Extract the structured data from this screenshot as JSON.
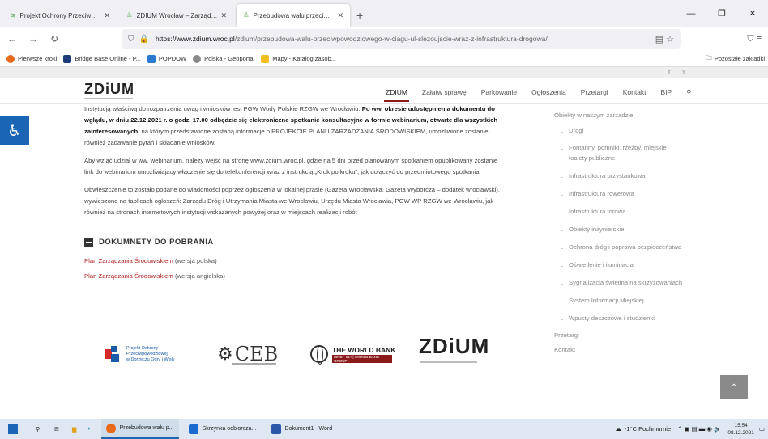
{
  "browser": {
    "tabs": [
      {
        "label": "Projekt Ochrony Przeciwpowod",
        "active": false
      },
      {
        "label": "ZDIUM Wrocław – Zarząd Dróg",
        "active": false
      },
      {
        "label": "Przebudowa wału przeciwpowo",
        "active": true
      }
    ],
    "new_tab": "+",
    "url_domain": "https://www.zdium.wroc.pl",
    "url_path": "/zdium/przebudowa-walu-przeciwpowodziowego-w-ciagu-ul-slezoujscie-wraz-z-infrastruktura-drogowa/",
    "bookmarks": [
      {
        "label": "Pierwsze kroki",
        "color": "#e86a1a"
      },
      {
        "label": "Bridge Base Online - P...",
        "color": "#1c3d7a"
      },
      {
        "label": "POPDOW",
        "color": "#2a7bd0"
      },
      {
        "label": "Polska - Geoportal",
        "color": "#8a8a8a"
      },
      {
        "label": "Mapy - Katalog zasob...",
        "color": "#f0c020"
      }
    ],
    "other_bookmarks": "Pozostałe zakładki"
  },
  "site": {
    "logo": "ZDiUM",
    "social": {
      "facebook": "f",
      "twitter": "𝕏"
    },
    "menu": [
      "ZDIUM",
      "Załatw sprawę",
      "Parkowanie",
      "Ogłoszenia",
      "Przetargi",
      "Kontakt",
      "BIP"
    ],
    "accent": "#8b1a1a"
  },
  "content": {
    "p1_a": "Instytucją właściwą do rozpatrzenia uwag i wniosków jest PGW Wody Polskie RZGW we Wrocławiu.",
    "p1_b": " Po ww. okresie udostępnienia dokumentu do wglądu, w dniu 22.12.2021 r. o godz. 17.00 odbędzie się elektroniczne spotkanie konsultacyjne w formie webinarium, otwarte dla wszystkich zainteresowanych,",
    "p1_c": " na którym przedstawione  zostaną informacje o PROJEKCIE PLANU ZARZADZANIA ŚRODOWISKIEM, umożliwione zostanie również zadawanie  pytań i składanie wniosków.",
    "p2": "Aby wziąć udział w ww. webinarium, należy wejść na stronę www.zdium.wroc.pl, gdzie na 5 dni przed planowanym spotkaniem opublikowany zostanie link do webinarium umożliwiający włączenie się do telekonferencji wraz z instrukcją „Krok po kroku”, jak dołączyć do przedmiotowego spotkania.",
    "p3": "Obwieszczenie to zostało podane do wiadomości poprzez ogłoszenia w lokalnej prasie (Gazeta Wrocławska, Gazeta Wyborcza – dodatek wrocławski), wywieszone na tablicach ogłoszeń: Zarządu Dróg i Utrzymania Miasta we Wrocławiu, Urzędu Miasta Wrocławia, PGW WP RZGW we Wrocławiu, jak również na stronach internetowych instytucji wskazanych powyżej oraz w miejscach realizacji robót",
    "downloads_heading": "DOKUMNETY DO POBRANIA",
    "download1_link": "Plan Zarządzania Środowiskiem",
    "download1_suffix": " (wersja polska)",
    "download2_link": "Plan Zarządzania Środowiskiem",
    "download2_suffix": " (wersja angielska)",
    "logos": {
      "project": [
        "Projekt Ochrony",
        "Przeciwpowodziowej",
        "w Dorzeczu Odry i Wisły"
      ],
      "ceb": "CEB",
      "worldbank": "THE WORLD BANK",
      "worldbank_sub": "IBRD • IDA | WORLD BANK GROUP",
      "zdium": "ZDiUM"
    }
  },
  "sidebar": {
    "top": "Obiekty w naszym zarządzie",
    "items": [
      "Drogi",
      "Fontanny, pomniki, rzeźby, miejskie",
      "toalety publiczne",
      "Infrastruktura przystankowa",
      "Infrastruktura rowerowa",
      "Infrastruktura torowa",
      "Obiekty inżynierskie",
      "Ochrona dróg i poprawa bezpieczeństwa",
      "Oświetlenie i iluminacja",
      "Sygnalizacja świetlna na skrzyżowaniach",
      "System Informacji Miejskiej",
      "Wpusty deszczowe i studzienki"
    ],
    "przetargi": "Przetargi",
    "kontakt": "Kontakt"
  },
  "taskbar": {
    "apps": [
      "Przebudowa wału p...",
      "Skrzynka odbiorcza...",
      "Dokument1 - Word"
    ],
    "weather": "-1°C  Pochmurnie",
    "time": "15:54",
    "date": "08.12.2021"
  }
}
